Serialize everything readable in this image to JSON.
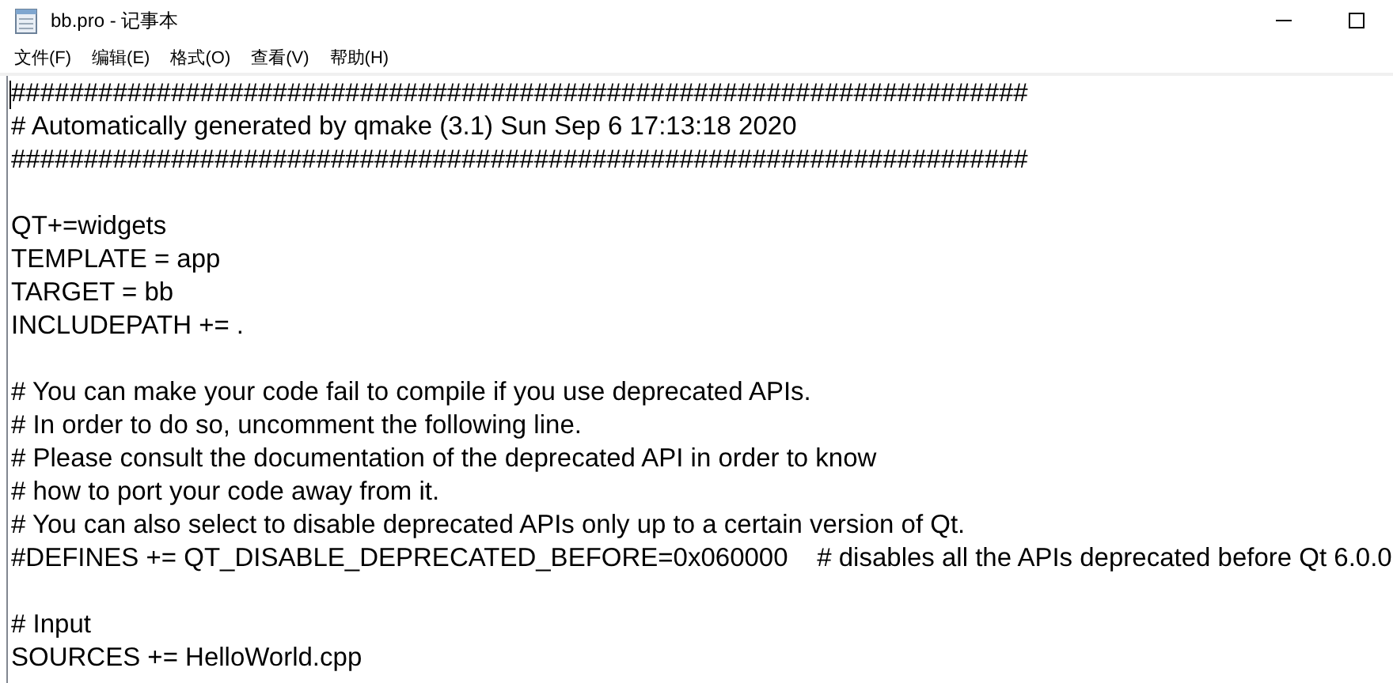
{
  "window": {
    "title": "bb.pro - 记事本"
  },
  "menu": [
    "文件(F)",
    "编辑(E)",
    "格式(O)",
    "查看(V)",
    "帮助(H)"
  ],
  "editor": {
    "lines": [
      {
        "kind": "text",
        "text": "######################################################################"
      },
      {
        "kind": "text",
        "text": "# Automatically generated by qmake (3.1) Sun Sep 6 17:13:18 2020"
      },
      {
        "kind": "text",
        "text": "######################################################################"
      },
      {
        "kind": "blank"
      },
      {
        "kind": "text",
        "text": "QT+=widgets"
      },
      {
        "kind": "text",
        "text": "TEMPLATE = app"
      },
      {
        "kind": "text",
        "text": "TARGET = bb"
      },
      {
        "kind": "text",
        "text": "INCLUDEPATH += ."
      },
      {
        "kind": "blank"
      },
      {
        "kind": "text",
        "text": "# You can make your code fail to compile if you use deprecated APIs."
      },
      {
        "kind": "text",
        "text": "# In order to do so, uncomment the following line."
      },
      {
        "kind": "text",
        "text": "# Please consult the documentation of the deprecated API in order to know"
      },
      {
        "kind": "text",
        "text": "# how to port your code away from it."
      },
      {
        "kind": "text",
        "text": "# You can also select to disable deprecated APIs only up to a certain version of Qt."
      },
      {
        "kind": "text",
        "text": "#DEFINES += QT_DISABLE_DEPRECATED_BEFORE=0x060000    # disables all the APIs deprecated before Qt 6.0.0"
      },
      {
        "kind": "blank"
      },
      {
        "kind": "text",
        "text": "# Input"
      },
      {
        "kind": "text",
        "text": "SOURCES += HelloWorld.cpp"
      }
    ]
  }
}
